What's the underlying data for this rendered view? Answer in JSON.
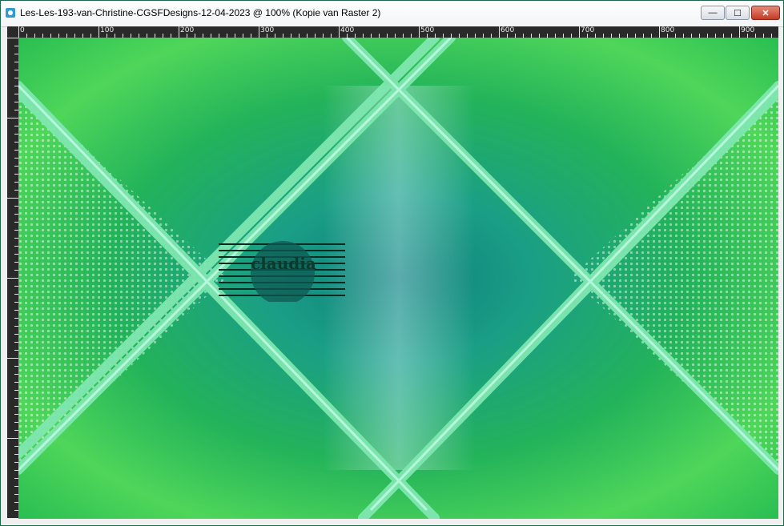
{
  "window": {
    "title": "Les-Les-193-van-Christine-CGSFDesigns-12-04-2023 @ 100% (Kopie van Raster 2)"
  },
  "controls": {
    "minimize_glyph": "—",
    "maximize_glyph": "☐",
    "close_glyph": "✕"
  },
  "ruler": {
    "top_labels": [
      "0",
      "100",
      "200",
      "300",
      "400",
      "500",
      "600",
      "700",
      "800",
      "900"
    ]
  },
  "canvas": {
    "watermark_text": "claudia"
  },
  "colors": {
    "accent_green": "#39d36a",
    "accent_teal": "#0f8a7a",
    "lattice_mint": "#7fe7b0"
  },
  "icons": {
    "app": "app-icon",
    "min": "minimize-icon",
    "max": "maximize-icon",
    "close": "close-icon"
  }
}
